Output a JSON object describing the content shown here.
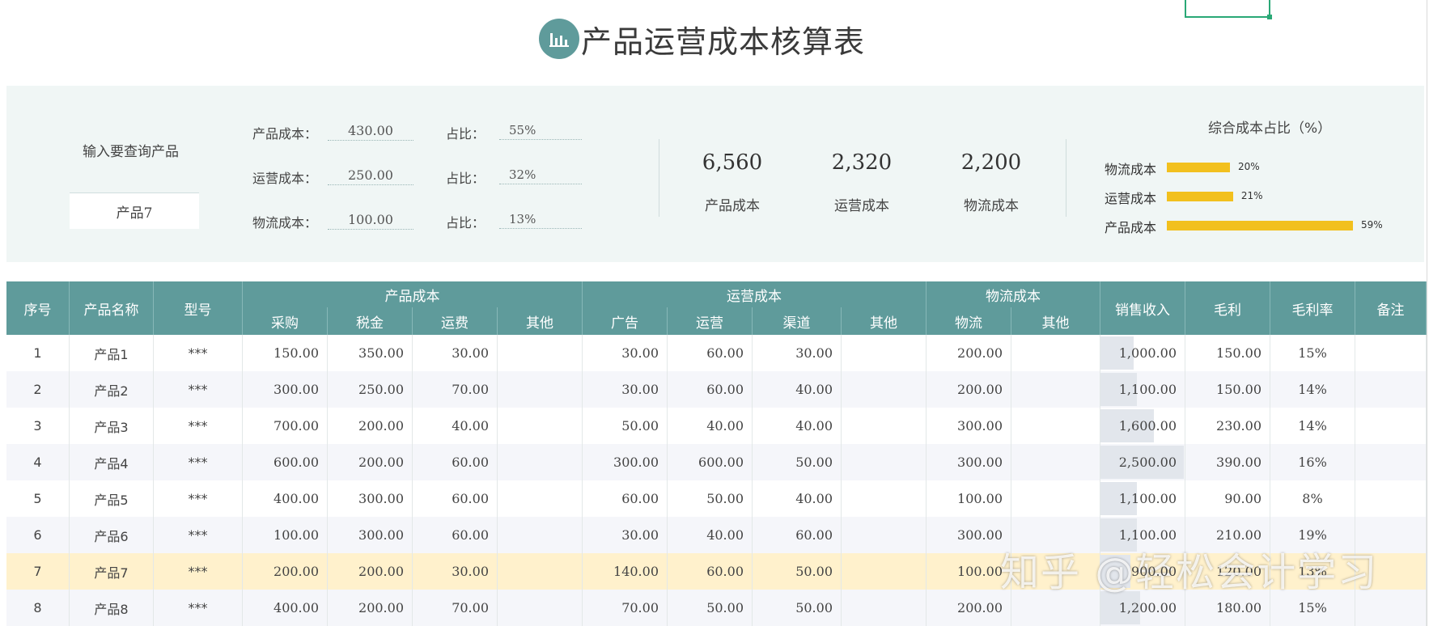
{
  "title": "产品运营成本核算表",
  "query": {
    "label": "输入要查询产品",
    "value": "产品7"
  },
  "breakdown": [
    {
      "label": "产品成本：",
      "value": "430.00",
      "pct_label": "占比：",
      "pct": "55%"
    },
    {
      "label": "运营成本：",
      "value": "250.00",
      "pct_label": "占比：",
      "pct": "32%"
    },
    {
      "label": "物流成本：",
      "value": "100.00",
      "pct_label": "占比：",
      "pct": "13%"
    }
  ],
  "totals": [
    {
      "value": "6,560",
      "label": "产品成本"
    },
    {
      "value": "2,320",
      "label": "运营成本"
    },
    {
      "value": "2,200",
      "label": "物流成本"
    }
  ],
  "bar_chart": {
    "title": "综合成本占比（%）",
    "color": "#f2c01e",
    "items": [
      {
        "label": "物流成本",
        "value": 20,
        "pct_text": "20%"
      },
      {
        "label": "运营成本",
        "value": 21,
        "pct_text": "21%"
      },
      {
        "label": "产品成本",
        "value": 59,
        "pct_text": "59%"
      }
    ]
  },
  "table": {
    "headers": {
      "seq": "序号",
      "name": "产品名称",
      "model": "型号",
      "product_cost": "产品成本",
      "operating_cost": "运营成本",
      "logistics_cost": "物流成本",
      "sales": "销售收入",
      "gross_profit": "毛利",
      "margin": "毛利率",
      "notes": "备注",
      "sub": {
        "purchase": "采购",
        "tax": "税金",
        "freight": "运费",
        "pc_other": "其他",
        "ads": "广告",
        "operations": "运营",
        "channel": "渠道",
        "oc_other": "其他",
        "logistics": "物流",
        "lc_other": "其他"
      }
    },
    "rows": [
      {
        "seq": "1",
        "name": "产品1",
        "model": "***",
        "purchase": "150.00",
        "tax": "350.00",
        "freight": "30.00",
        "pc_other": "",
        "ads": "30.00",
        "operations": "60.00",
        "channel": "30.00",
        "oc_other": "",
        "logistics": "200.00",
        "lc_other": "",
        "sales": "1,000.00",
        "sales_value": 1000,
        "gross_profit": "150.00",
        "margin": "15%",
        "notes": ""
      },
      {
        "seq": "2",
        "name": "产品2",
        "model": "***",
        "purchase": "300.00",
        "tax": "250.00",
        "freight": "70.00",
        "pc_other": "",
        "ads": "30.00",
        "operations": "60.00",
        "channel": "40.00",
        "oc_other": "",
        "logistics": "200.00",
        "lc_other": "",
        "sales": "1,100.00",
        "sales_value": 1100,
        "gross_profit": "150.00",
        "margin": "14%",
        "notes": ""
      },
      {
        "seq": "3",
        "name": "产品3",
        "model": "***",
        "purchase": "700.00",
        "tax": "200.00",
        "freight": "40.00",
        "pc_other": "",
        "ads": "50.00",
        "operations": "40.00",
        "channel": "40.00",
        "oc_other": "",
        "logistics": "300.00",
        "lc_other": "",
        "sales": "1,600.00",
        "sales_value": 1600,
        "gross_profit": "230.00",
        "margin": "14%",
        "notes": ""
      },
      {
        "seq": "4",
        "name": "产品4",
        "model": "***",
        "purchase": "600.00",
        "tax": "200.00",
        "freight": "60.00",
        "pc_other": "",
        "ads": "300.00",
        "operations": "600.00",
        "channel": "50.00",
        "oc_other": "",
        "logistics": "300.00",
        "lc_other": "",
        "sales": "2,500.00",
        "sales_value": 2500,
        "gross_profit": "390.00",
        "margin": "16%",
        "notes": ""
      },
      {
        "seq": "5",
        "name": "产品5",
        "model": "***",
        "purchase": "400.00",
        "tax": "300.00",
        "freight": "60.00",
        "pc_other": "",
        "ads": "60.00",
        "operations": "50.00",
        "channel": "40.00",
        "oc_other": "",
        "logistics": "100.00",
        "lc_other": "",
        "sales": "1,100.00",
        "sales_value": 1100,
        "gross_profit": "90.00",
        "margin": "8%",
        "notes": ""
      },
      {
        "seq": "6",
        "name": "产品6",
        "model": "***",
        "purchase": "100.00",
        "tax": "300.00",
        "freight": "60.00",
        "pc_other": "",
        "ads": "30.00",
        "operations": "40.00",
        "channel": "60.00",
        "oc_other": "",
        "logistics": "300.00",
        "lc_other": "",
        "sales": "1,100.00",
        "sales_value": 1100,
        "gross_profit": "210.00",
        "margin": "19%",
        "notes": ""
      },
      {
        "seq": "7",
        "name": "产品7",
        "model": "***",
        "purchase": "200.00",
        "tax": "200.00",
        "freight": "30.00",
        "pc_other": "",
        "ads": "140.00",
        "operations": "60.00",
        "channel": "50.00",
        "oc_other": "",
        "logistics": "100.00",
        "lc_other": "",
        "sales": "900.00",
        "sales_value": 900,
        "gross_profit": "120.00",
        "margin": "13%",
        "notes": "",
        "highlight": true
      },
      {
        "seq": "8",
        "name": "产品8",
        "model": "***",
        "purchase": "400.00",
        "tax": "200.00",
        "freight": "70.00",
        "pc_other": "",
        "ads": "70.00",
        "operations": "50.00",
        "channel": "50.00",
        "oc_other": "",
        "logistics": "200.00",
        "lc_other": "",
        "sales": "1,200.00",
        "sales_value": 1200,
        "gross_profit": "180.00",
        "margin": "15%",
        "notes": ""
      }
    ],
    "colors": {
      "header_bg": "#5f9b9b",
      "row_alt_bg": "#f5f6fa",
      "highlight_bg": "#fff1cc",
      "sales_bar": "#e2e6ec"
    }
  },
  "watermark": "知乎 @轻松会计学习"
}
